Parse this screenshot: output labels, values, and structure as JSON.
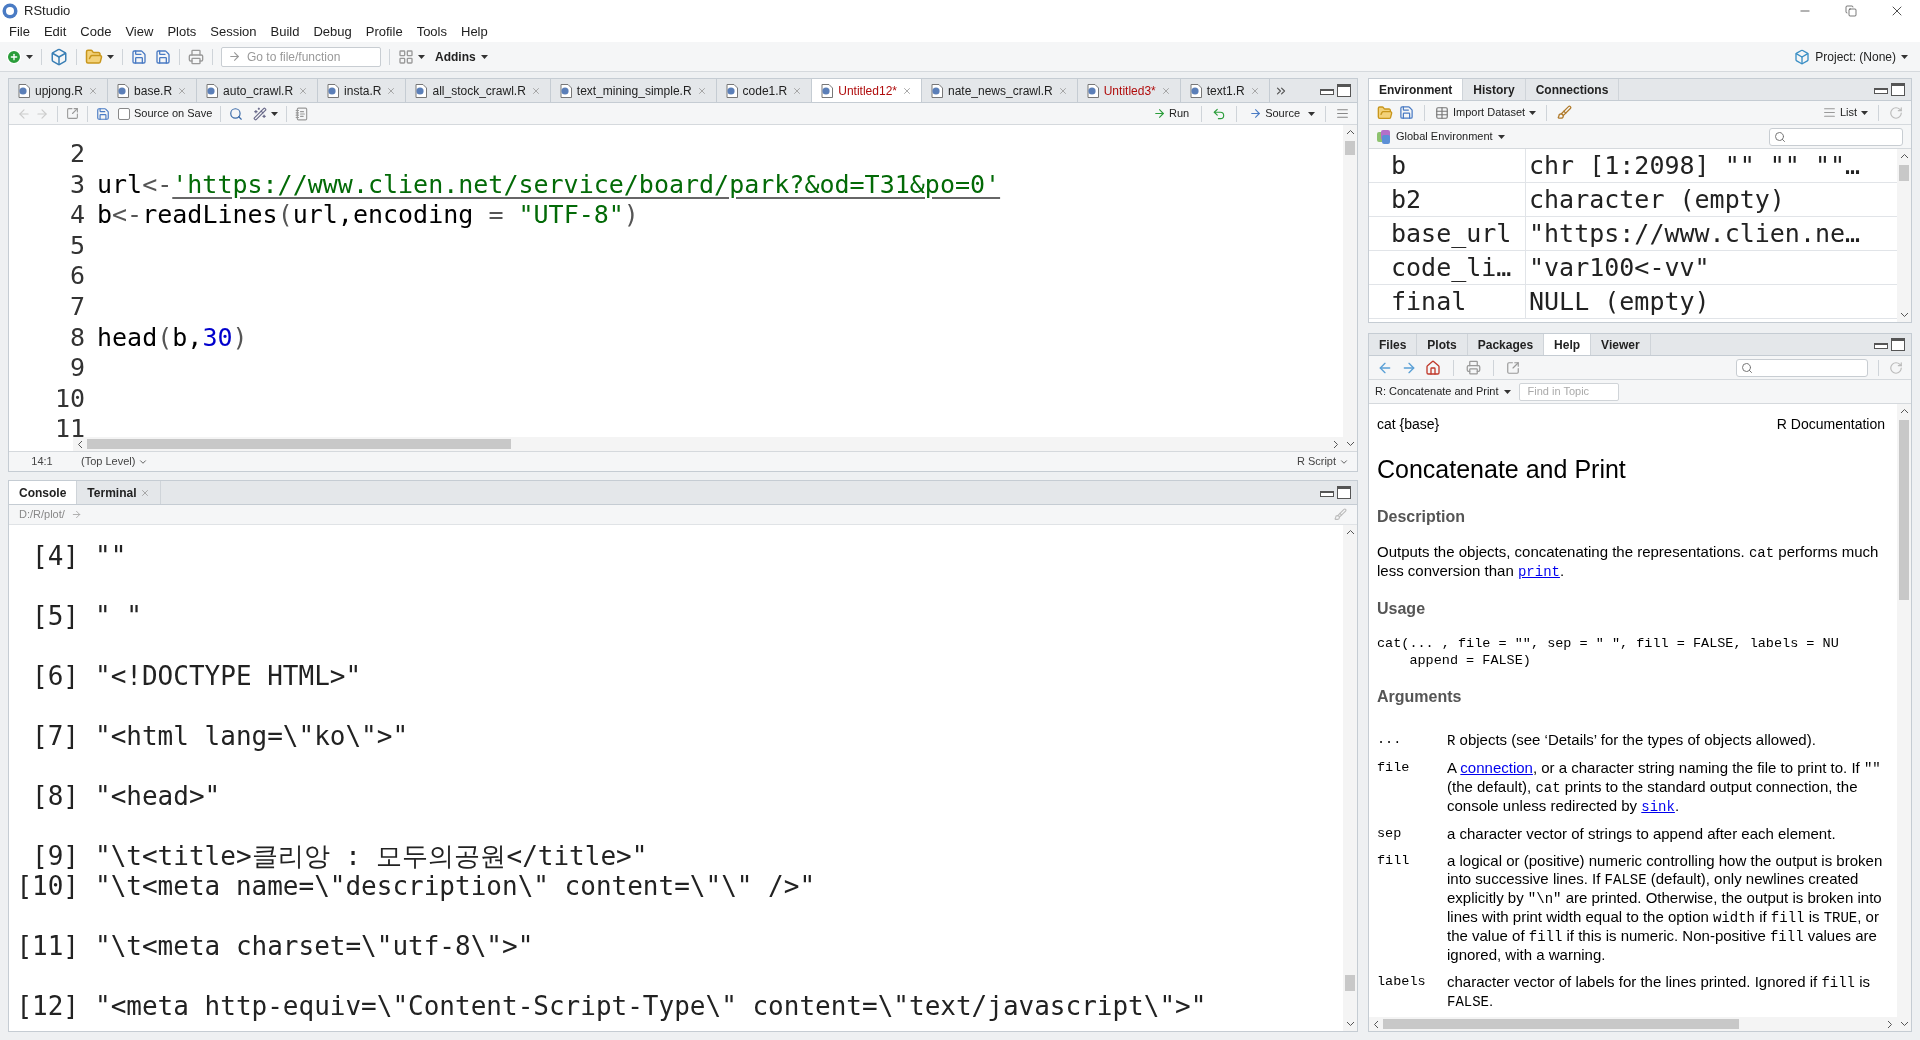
{
  "window": {
    "title": "RStudio"
  },
  "menu": [
    "File",
    "Edit",
    "Code",
    "View",
    "Plots",
    "Session",
    "Build",
    "Debug",
    "Profile",
    "Tools",
    "Help"
  ],
  "toolbar": {
    "goto_placeholder": "Go to file/function",
    "addins": "Addins",
    "project": "Project: (None)"
  },
  "editor": {
    "tabs": [
      {
        "label": "upjong.R",
        "selected": false,
        "modified": false
      },
      {
        "label": "base.R",
        "selected": false,
        "modified": false
      },
      {
        "label": "auto_crawl.R",
        "selected": false,
        "modified": false
      },
      {
        "label": "insta.R",
        "selected": false,
        "modified": false
      },
      {
        "label": "all_stock_crawl.R",
        "selected": false,
        "modified": false
      },
      {
        "label": "text_mining_simple.R",
        "selected": false,
        "modified": false
      },
      {
        "label": "code1.R",
        "selected": false,
        "modified": false
      },
      {
        "label": "Untitled12*",
        "selected": true,
        "modified": true
      },
      {
        "label": "nate_news_crawl.R",
        "selected": false,
        "modified": false
      },
      {
        "label": "Untitled3*",
        "selected": false,
        "modified": true
      },
      {
        "label": "text1.R",
        "selected": false,
        "modified": false
      }
    ],
    "toolbar": {
      "source_on_save": {
        "label": "Source on Save",
        "checked": false
      },
      "run": "Run",
      "source": "Source"
    },
    "lines": [
      {
        "number": "2"
      },
      {
        "number": "3",
        "tokens": [
          {
            "kind": "code",
            "text": "url"
          },
          {
            "kind": "op",
            "text": "<-"
          },
          {
            "kind": "link",
            "text": "'https://www.clien.net/service/board/park?&od=T31&po=0'"
          }
        ]
      },
      {
        "number": "4",
        "tokens": [
          {
            "kind": "code",
            "text": "b"
          },
          {
            "kind": "op",
            "text": "<-"
          },
          {
            "kind": "code",
            "text": "readLines"
          },
          {
            "kind": "op",
            "text": "("
          },
          {
            "kind": "code",
            "text": "url,encoding"
          },
          {
            "kind": "op",
            "text": " = "
          },
          {
            "kind": "string",
            "text": "\"UTF-8\""
          },
          {
            "kind": "op",
            "text": ")"
          }
        ]
      },
      {
        "number": "5"
      },
      {
        "number": "6"
      },
      {
        "number": "7"
      },
      {
        "number": "8",
        "tokens": [
          {
            "kind": "code",
            "text": "head"
          },
          {
            "kind": "op",
            "text": "("
          },
          {
            "kind": "code",
            "text": "b,"
          },
          {
            "kind": "number",
            "text": "30"
          },
          {
            "kind": "op",
            "text": ")"
          }
        ]
      },
      {
        "number": "9"
      },
      {
        "number": "10"
      },
      {
        "number": "11"
      }
    ],
    "status": {
      "position": "14:1",
      "scope": "(Top Level)",
      "file_type": "R Script"
    }
  },
  "console": {
    "tabs": [
      {
        "label": "Console",
        "selected": true,
        "closable": false
      },
      {
        "label": "Terminal",
        "selected": false,
        "closable": true
      }
    ],
    "path": "D:/R/plot/",
    "lines": [
      {
        "index": "[4]",
        "text": "\"\"",
        "spaced": true
      },
      {
        "index": "[5]",
        "text": "\" \"",
        "spaced": true
      },
      {
        "index": "[6]",
        "text": "\"<!DOCTYPE HTML>\"",
        "spaced": true
      },
      {
        "index": "[7]",
        "text": "\"<html lang=\\\"ko\\\">\"",
        "spaced": true
      },
      {
        "index": "[8]",
        "text": "\"<head>\"",
        "spaced": true
      },
      {
        "index": "[9]",
        "text": "\"\\t<title>클리앙 : 모두의공원</title>\"",
        "spaced": false
      },
      {
        "index": "[10]",
        "text": "\"\\t<meta name=\\\"description\\\" content=\\\"\\\" />\"",
        "spaced": true
      },
      {
        "index": "[11]",
        "text": "\"\\t<meta charset=\\\"utf-8\\\">\"",
        "spaced": true
      },
      {
        "index": "[12]",
        "text": "\"<meta http-equiv=\\\"Content-Script-Type\\\" content=\\\"text/javascript\\\">\"",
        "spaced": false
      }
    ]
  },
  "environment": {
    "tabs": [
      {
        "label": "Environment",
        "selected": true
      },
      {
        "label": "History",
        "selected": false
      },
      {
        "label": "Connections",
        "selected": false
      }
    ],
    "import": "Import Dataset",
    "view": "List",
    "scope": "Global Environment",
    "rows": [
      {
        "name": "b",
        "value": "chr [1:2098] \"\" \"\" \"\"…"
      },
      {
        "name": "b2",
        "value": "character (empty)"
      },
      {
        "name": "base_url",
        "value": "\"https://www.clien.ne…"
      },
      {
        "name": "code_li…",
        "value": "\"var100<-vv\""
      },
      {
        "name": "final",
        "value": "NULL (empty)"
      }
    ]
  },
  "help_pane": {
    "tabs": [
      {
        "label": "Files",
        "selected": false
      },
      {
        "label": "Plots",
        "selected": false
      },
      {
        "label": "Packages",
        "selected": false
      },
      {
        "label": "Help",
        "selected": true
      },
      {
        "label": "Viewer",
        "selected": false
      }
    ],
    "topic": "R: Concatenate and Print",
    "find_placeholder": "Find in Topic",
    "doc": {
      "package": "cat {base}",
      "source": "R Documentation",
      "title": "Concatenate and Print",
      "sections": [
        {
          "kind": "paragraph",
          "heading": "Description",
          "segments": [
            {
              "kind": "text",
              "text": "Outputs the objects, concatenating the representations. "
            },
            {
              "kind": "code",
              "text": "cat"
            },
            {
              "kind": "text",
              "text": " performs much less conversion than "
            },
            {
              "kind": "link_code",
              "text": "print"
            },
            {
              "kind": "text",
              "text": "."
            }
          ]
        },
        {
          "kind": "code",
          "heading": "Usage",
          "lines": [
            "cat(... , file = \"\", sep = \" \", fill = FALSE, labels = NU",
            "    append = FALSE)"
          ]
        },
        {
          "kind": "arguments",
          "heading": "Arguments",
          "items": [
            {
              "term": "...",
              "segments": [
                {
                  "kind": "code",
                  "text": "R"
                },
                {
                  "kind": "text",
                  "text": " objects (see ‘Details’ for the types of objects allowed)."
                }
              ]
            },
            {
              "term": "file",
              "segments": [
                {
                  "kind": "text",
                  "text": "A "
                },
                {
                  "kind": "link",
                  "text": "connection"
                },
                {
                  "kind": "text",
                  "text": ", or a character string naming the file to print to. If "
                },
                {
                  "kind": "code",
                  "text": "\"\""
                },
                {
                  "kind": "text",
                  "text": " (the default), "
                },
                {
                  "kind": "code",
                  "text": "cat"
                },
                {
                  "kind": "text",
                  "text": " prints to the standard output connection, the console unless redirected by "
                },
                {
                  "kind": "link_code",
                  "text": "sink"
                },
                {
                  "kind": "text",
                  "text": "."
                }
              ]
            },
            {
              "term": "sep",
              "segments": [
                {
                  "kind": "text",
                  "text": "a character vector of strings to append after each element."
                }
              ]
            },
            {
              "term": "fill",
              "segments": [
                {
                  "kind": "text",
                  "text": "a logical or (positive) numeric controlling how the output is broken into successive lines. If "
                },
                {
                  "kind": "code",
                  "text": "FALSE"
                },
                {
                  "kind": "text",
                  "text": " (default), only newlines created explicitly by "
                },
                {
                  "kind": "code",
                  "text": "\"\\n\""
                },
                {
                  "kind": "text",
                  "text": " are printed. Otherwise, the output is broken into lines with print width equal to the option "
                },
                {
                  "kind": "code",
                  "text": "width"
                },
                {
                  "kind": "text",
                  "text": " if "
                },
                {
                  "kind": "code",
                  "text": "fill"
                },
                {
                  "kind": "text",
                  "text": " is "
                },
                {
                  "kind": "code",
                  "text": "TRUE"
                },
                {
                  "kind": "text",
                  "text": ", or the value of "
                },
                {
                  "kind": "code",
                  "text": "fill"
                },
                {
                  "kind": "text",
                  "text": " if this is numeric. Non-positive "
                },
                {
                  "kind": "code",
                  "text": "fill"
                },
                {
                  "kind": "text",
                  "text": " values are ignored, with a warning."
                }
              ]
            },
            {
              "term": "labels",
              "segments": [
                {
                  "kind": "text",
                  "text": "character vector of labels for the lines printed. Ignored if "
                },
                {
                  "kind": "code",
                  "text": "fill"
                },
                {
                  "kind": "text",
                  "text": " is "
                },
                {
                  "kind": "code",
                  "text": "FALSE"
                },
                {
                  "kind": "text",
                  "text": "."
                }
              ]
            }
          ]
        }
      ]
    }
  }
}
